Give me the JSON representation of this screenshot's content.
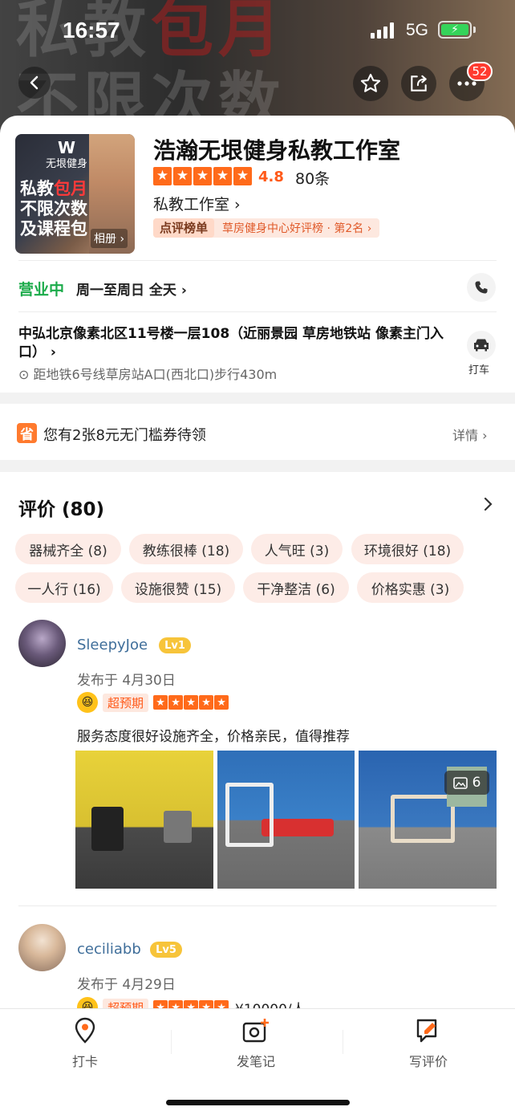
{
  "status_bar": {
    "time": "16:57",
    "network": "5G"
  },
  "hero": {
    "banner_line1": "私教",
    "banner_line1_highlight": "包月",
    "banner_line2": "不限次数"
  },
  "nav": {
    "more_badge": "52"
  },
  "shop": {
    "thumb_logo_text": "无垠健身",
    "thumb_line1": "私教",
    "thumb_line1_highlight": "包月",
    "thumb_line2": "不限次数",
    "thumb_line3": "及课程包",
    "album_label": "相册",
    "name": "浩瀚无垠健身私教工作室",
    "rating": "4.8",
    "review_count": "80条",
    "category": "私教工作室",
    "rank_tag": "点评榜单",
    "rank_text": "草房健身中心好评榜 · 第2名"
  },
  "hours": {
    "status": "营业中",
    "text": "周一至周日 全天"
  },
  "location": {
    "address": "中弘北京像素北区11号楼一层108（近丽景园 草房地铁站 像素主门入口）",
    "distance": "距地铁6号线草房站A口(西北口)步行430m",
    "taxi_label": "打车"
  },
  "coupon": {
    "icon": "省",
    "text": "您有2张8元无门槛券待领",
    "detail": "详情"
  },
  "reviews": {
    "title": "评价 (80)",
    "tags": [
      "器械齐全 (8)",
      "教练很棒 (18)",
      "人气旺 (3)",
      "环境很好 (18)",
      "一人行 (16)",
      "设施很赞 (15)",
      "干净整洁 (6)",
      "价格实惠 (3)"
    ],
    "items": [
      {
        "user": "SleepyJoe",
        "level": "Lv1",
        "posted": "发布于 4月30日",
        "mood": "超预期",
        "text": "服务态度很好设施齐全，价格亲民，值得推荐",
        "photo_count": "6"
      },
      {
        "user": "ceciliabb",
        "level": "Lv5",
        "posted": "发布于 4月29日",
        "mood": "超预期",
        "text": "¥10000/人"
      }
    ]
  },
  "bottom_bar": {
    "tabs": [
      "打卡",
      "发笔记",
      "写评价"
    ]
  },
  "colors": {
    "accent": "#ff6a1a",
    "open_green": "#1bab4a",
    "username_blue": "#3f6e9a",
    "level_gold": "#f7c43a"
  }
}
